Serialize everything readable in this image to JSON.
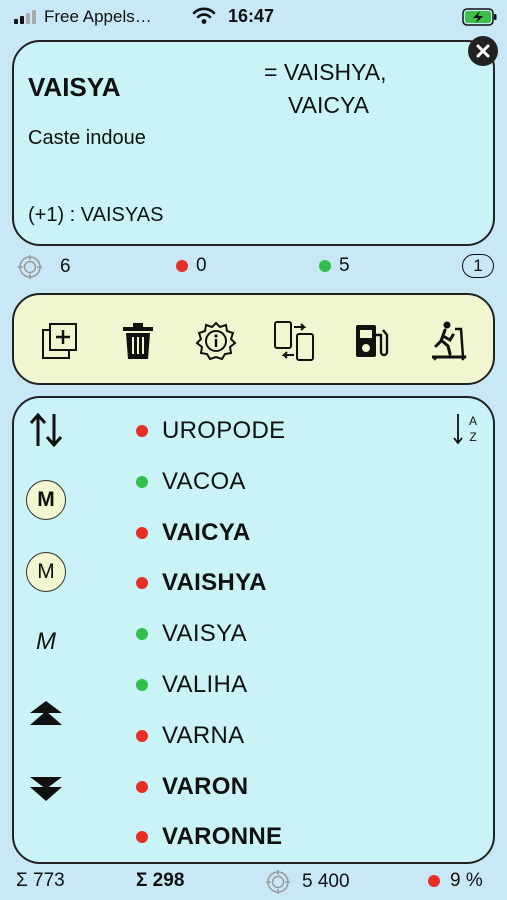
{
  "status_bar": {
    "carrier": "Free Appels…",
    "time": "16:47",
    "wifi_icon": "wifi-icon",
    "battery_icon": "battery-charging-icon"
  },
  "word_card": {
    "headword": "VAISYA",
    "variants_line1": "= VAISHYA,",
    "variants_line2": "VAICYA",
    "definition": "Caste indoue",
    "plural": "(+1) : VAISYAS",
    "close_icon": "close-icon"
  },
  "stats": {
    "target_count": "6",
    "red_count": "0",
    "green_count": "5",
    "badge": "1"
  },
  "toolbar": {
    "icons": [
      "add-copy-icon",
      "trash-icon",
      "settings-info-icon",
      "sync-devices-icon",
      "fuel-station-icon",
      "treadmill-icon"
    ]
  },
  "side_controls": {
    "sort_icon": "sort-arrows-icon",
    "m_bold": "M",
    "m_regular": "M",
    "m_italic": "M",
    "scroll_up_icon": "scroll-top-icon",
    "scroll_down_icon": "scroll-bottom-icon",
    "az_icon": "sort-az-icon"
  },
  "word_list": [
    {
      "word": "UROPODE",
      "color": "red",
      "bold": false
    },
    {
      "word": "VACOA",
      "color": "green",
      "bold": false
    },
    {
      "word": "VAICYA",
      "color": "red",
      "bold": true
    },
    {
      "word": "VAISHYA",
      "color": "red",
      "bold": true
    },
    {
      "word": "VAISYA",
      "color": "green",
      "bold": false
    },
    {
      "word": "VALIHA",
      "color": "green",
      "bold": false
    },
    {
      "word": "VARNA",
      "color": "red",
      "bold": false
    },
    {
      "word": "VARON",
      "color": "red",
      "bold": true
    },
    {
      "word": "VARONNE",
      "color": "red",
      "bold": true
    }
  ],
  "footer": {
    "sigma_total": "Σ 773",
    "sigma_bold": "Σ 298",
    "target_total": "5 400",
    "percent": "9 %"
  },
  "colors": {
    "background": "#c9e8f6",
    "card": "#c9f3f6",
    "toolbar": "#f1f6d0",
    "red": "#e63027",
    "green": "#2fbf4a"
  }
}
